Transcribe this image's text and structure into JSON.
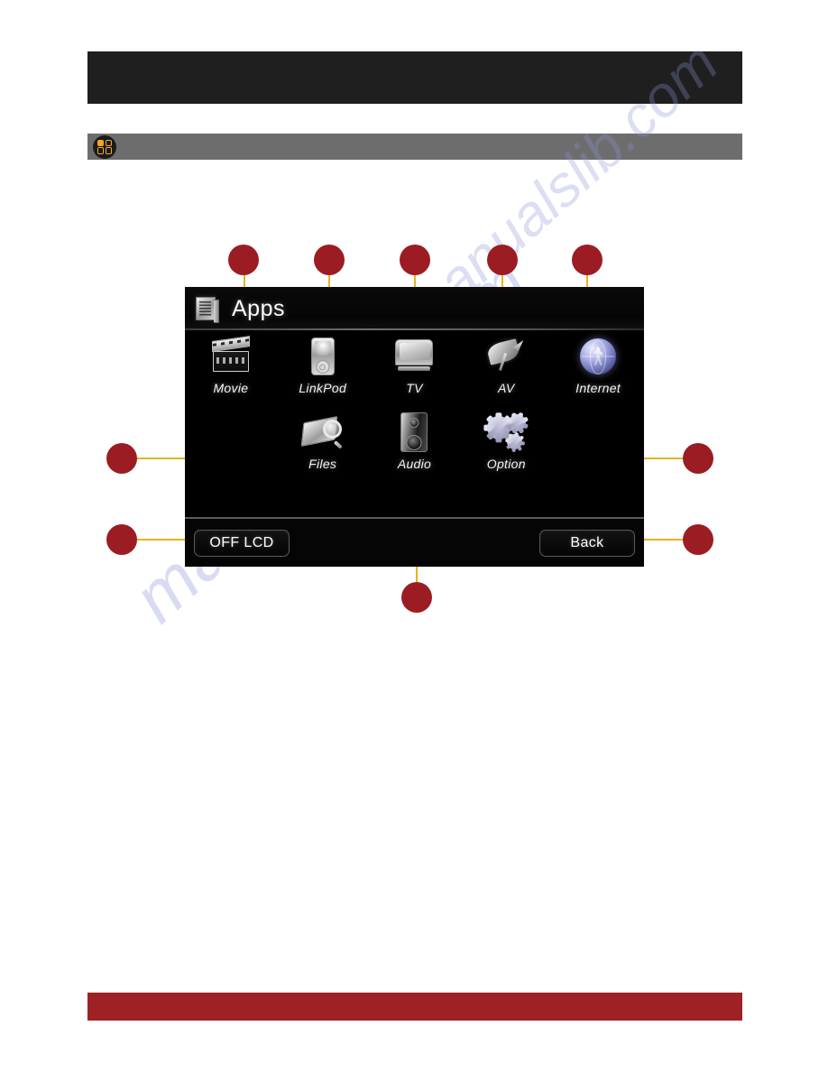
{
  "page": {
    "background_color": "#ffffff",
    "header_band_color": "#201f1f",
    "section_bar_color": "#6d6d6d",
    "footer_band_color": "#9e2126",
    "callout_color": "#9b1d23",
    "leader_color": "#e8b21a",
    "accent_yellow": "#f5a81c"
  },
  "section_bar": {
    "badge_icon": "apps-grid-icon",
    "title": ""
  },
  "device": {
    "title": "Apps",
    "title_icon": "list-document-icon",
    "apps": [
      {
        "label": "Movie",
        "icon": "movie-clapperboard-icon"
      },
      {
        "label": "LinkPod",
        "icon": "media-player-icon"
      },
      {
        "label": "TV",
        "icon": "television-icon"
      },
      {
        "label": "AV",
        "icon": "satellite-dish-icon"
      },
      {
        "label": "Internet",
        "icon": "globe-internet-icon"
      },
      {
        "label": "Files",
        "icon": "files-search-icon"
      },
      {
        "label": "Audio",
        "icon": "speaker-icon"
      },
      {
        "label": "Option",
        "icon": "gears-settings-icon"
      }
    ],
    "buttons": {
      "off_lcd": "OFF LCD",
      "back": "Back"
    }
  },
  "callouts": [
    {
      "id": "callout-movie",
      "target": "Movie"
    },
    {
      "id": "callout-linkpod",
      "target": "LinkPod"
    },
    {
      "id": "callout-tv",
      "target": "TV"
    },
    {
      "id": "callout-av",
      "target": "AV"
    },
    {
      "id": "callout-internet",
      "target": "Internet"
    },
    {
      "id": "callout-files",
      "target": "Files"
    },
    {
      "id": "callout-option",
      "target": "Option"
    },
    {
      "id": "callout-off-lcd",
      "target": "OFF LCD"
    },
    {
      "id": "callout-back",
      "target": "Back"
    },
    {
      "id": "callout-audio",
      "target": "Audio"
    }
  ],
  "watermark": {
    "line1": "manualslib.com",
    "line2": "manualslib.com"
  }
}
